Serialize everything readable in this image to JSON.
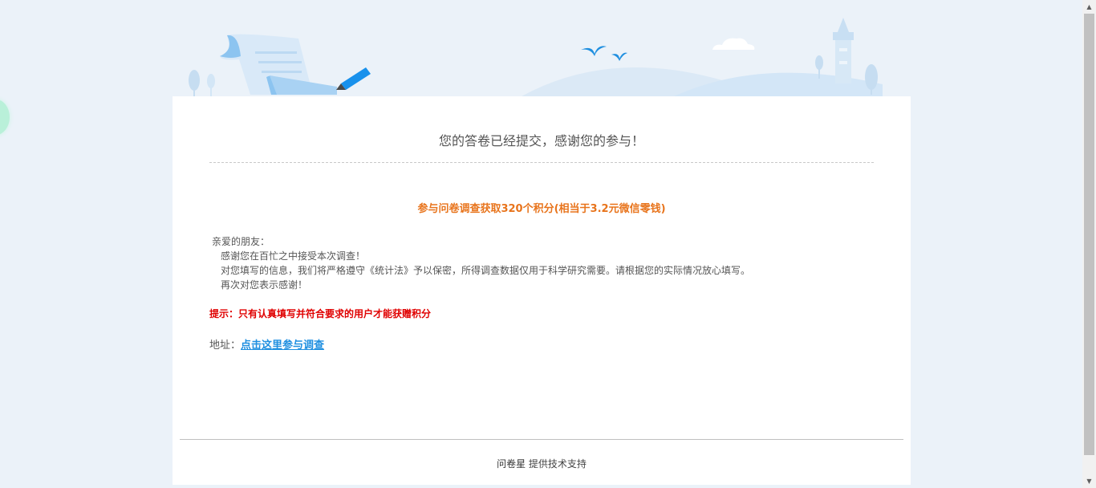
{
  "survey": {
    "title": "您的答卷已经提交，感谢您的参与！",
    "reward": "参与问卷调查获取320个积分(相当于3.2元微信零钱)",
    "letter": {
      "greeting": "亲爱的朋友：",
      "line1": "感谢您在百忙之中接受本次调查！",
      "line2": "对您填写的信息，我们将严格遵守《统计法》予以保密，所得调查数据仅用于科学研究需要。请根据您的实际情况放心填写。",
      "line3": "再次对您表示感谢！"
    },
    "tip": "提示：只有认真填写并符合要求的用户才能获赠积分",
    "address_label": "地址：",
    "address_link": "点击这里参与调查"
  },
  "footer": {
    "brand": "问卷星",
    "text": "提供技术支持"
  },
  "colors": {
    "background": "#ebf2f9",
    "reward": "#e8741c",
    "tip": "#e00000",
    "link": "#1f8fe0"
  }
}
